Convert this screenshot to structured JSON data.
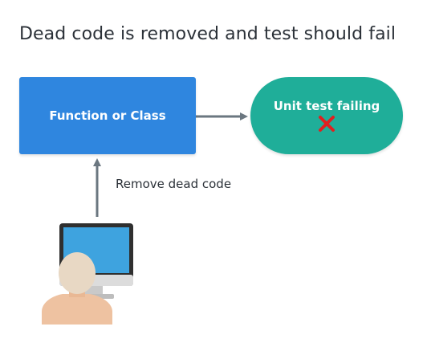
{
  "title": "Dead code is removed and test should fail",
  "nodes": {
    "function_box": {
      "label": "Function or Class",
      "color": "#2f86df"
    },
    "unit_test": {
      "label": "Unit test failing",
      "color": "#1fae99",
      "status_icon": "red-cross-icon",
      "status_color": "#e02020"
    }
  },
  "edges": {
    "developer_to_function": {
      "label": "Remove dead code"
    },
    "function_to_test": {
      "label": ""
    }
  },
  "actor": {
    "icon": "developer-at-computer-icon"
  },
  "colors": {
    "arrow": "#6b7780"
  }
}
